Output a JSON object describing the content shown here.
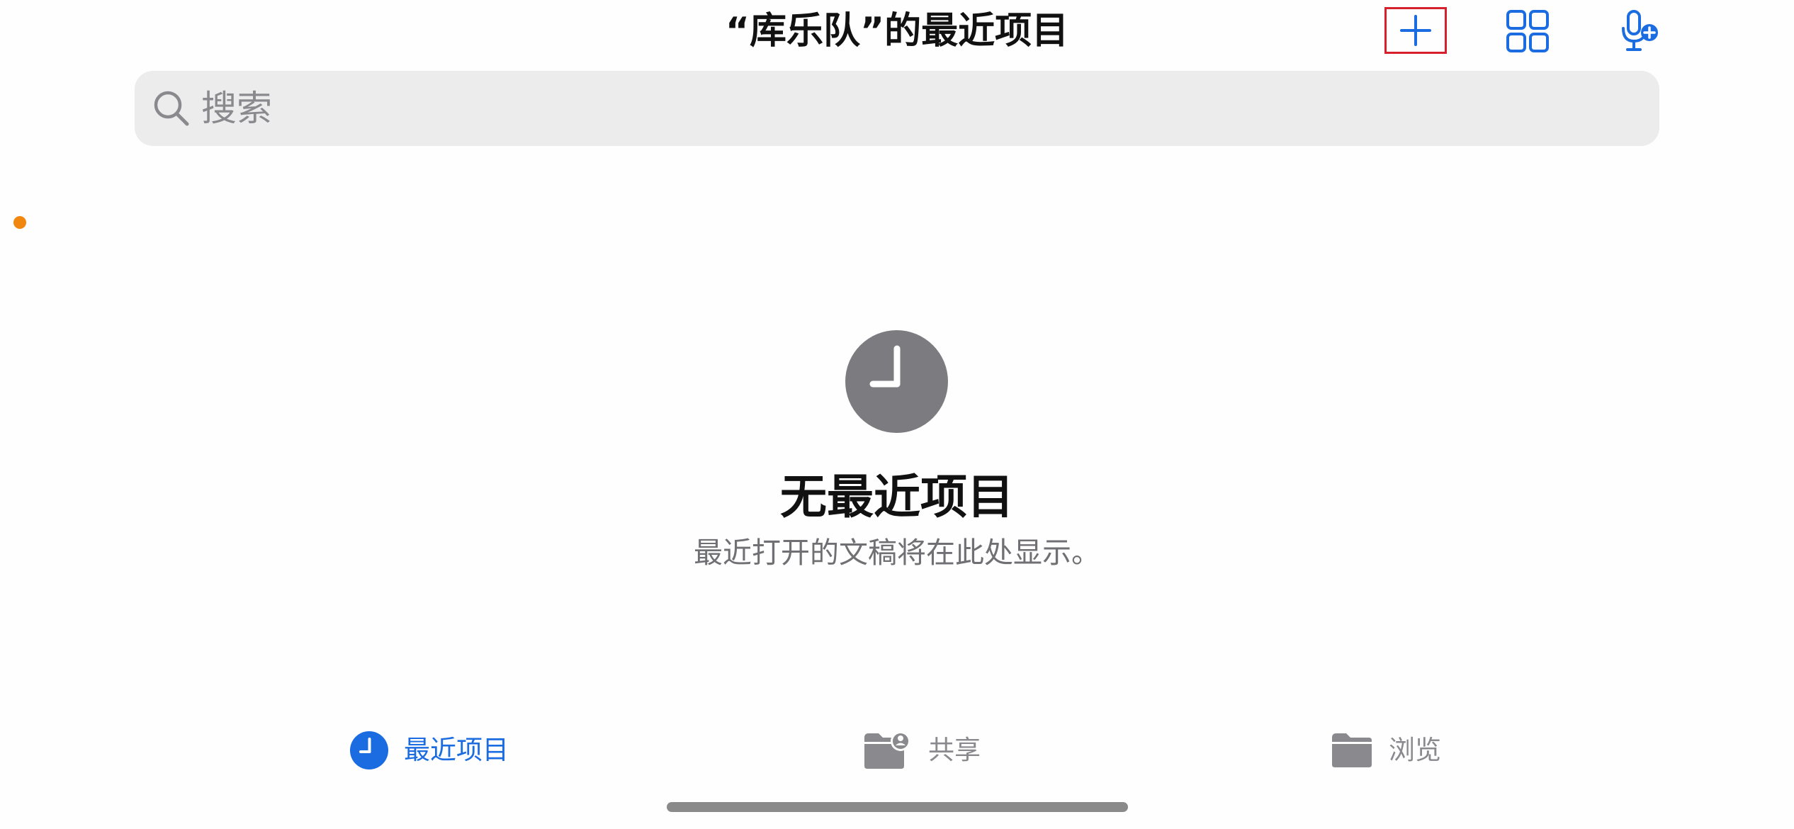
{
  "header": {
    "title": "“库乐队”的最近项目",
    "icons": [
      "plus-icon",
      "grid-view-icon",
      "mic-add-icon"
    ]
  },
  "search": {
    "placeholder": "搜索",
    "value": ""
  },
  "empty_state": {
    "icon": "clock-icon",
    "title": "无最近项目",
    "subtitle": "最近打开的文稿将在此处显示。"
  },
  "tabs": [
    {
      "label": "最近项目",
      "icon": "clock-icon",
      "selected": true
    },
    {
      "label": "共享",
      "icon": "shared-folder-icon",
      "selected": false
    },
    {
      "label": "浏览",
      "icon": "folder-icon",
      "selected": false
    }
  ],
  "colors": {
    "accent": "#1a6ce0",
    "inactive": "#8a8a8e",
    "highlight_box": "#d6212c",
    "indicator_dot": "#f2870f",
    "empty_icon": "#7c7c80"
  }
}
